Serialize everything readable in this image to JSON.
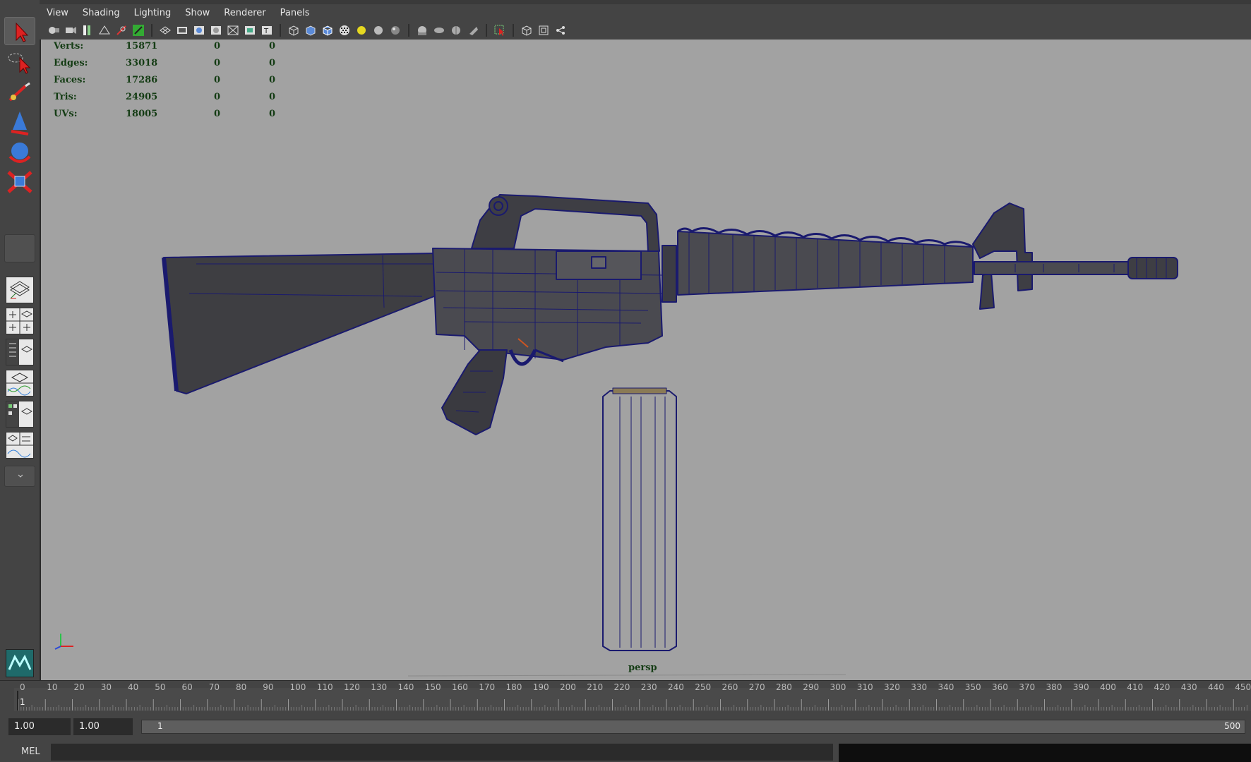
{
  "menu": [
    "View",
    "Shading",
    "Lighting",
    "Show",
    "Renderer",
    "Panels"
  ],
  "hud": {
    "rows": [
      {
        "label": "Verts:",
        "v1": "15871",
        "v2": "0",
        "v3": "0"
      },
      {
        "label": "Edges:",
        "v1": "33018",
        "v2": "0",
        "v3": "0"
      },
      {
        "label": "Faces:",
        "v1": "17286",
        "v2": "0",
        "v3": "0"
      },
      {
        "label": "Tris:",
        "v1": "24905",
        "v2": "0",
        "v3": "0"
      },
      {
        "label": "UVs:",
        "v1": "18005",
        "v2": "0",
        "v3": "0"
      }
    ]
  },
  "camera": "persp",
  "timeline": {
    "ticks": [
      "0",
      "10",
      "20",
      "30",
      "40",
      "50",
      "60",
      "70",
      "80",
      "90",
      "100",
      "110",
      "120",
      "130",
      "140",
      "150",
      "160",
      "170",
      "180",
      "190",
      "200",
      "210",
      "220",
      "230",
      "240",
      "250",
      "260",
      "270",
      "280",
      "290",
      "300",
      "310",
      "320",
      "330",
      "340",
      "350",
      "360",
      "370",
      "380",
      "390",
      "400",
      "410",
      "420",
      "430",
      "440",
      "450"
    ],
    "current_frame": "1"
  },
  "range": {
    "start_time": "1.00",
    "start_playback": "1.00",
    "range_start": "1",
    "range_end": "500"
  },
  "command": {
    "language": "MEL"
  },
  "toolbox": {
    "tools": [
      "select-tool-icon",
      "lasso-select-icon",
      "paint-select-icon",
      "move-tool-icon",
      "rotate-tool-icon",
      "scale-tool-icon"
    ],
    "logo_text": "MAYA"
  },
  "colors": {
    "viewport_bg": "#a2a2a2",
    "wireframe": "#1a1a6e",
    "mesh_fill": "#4a4a4e",
    "hud_text": "#143c14"
  }
}
